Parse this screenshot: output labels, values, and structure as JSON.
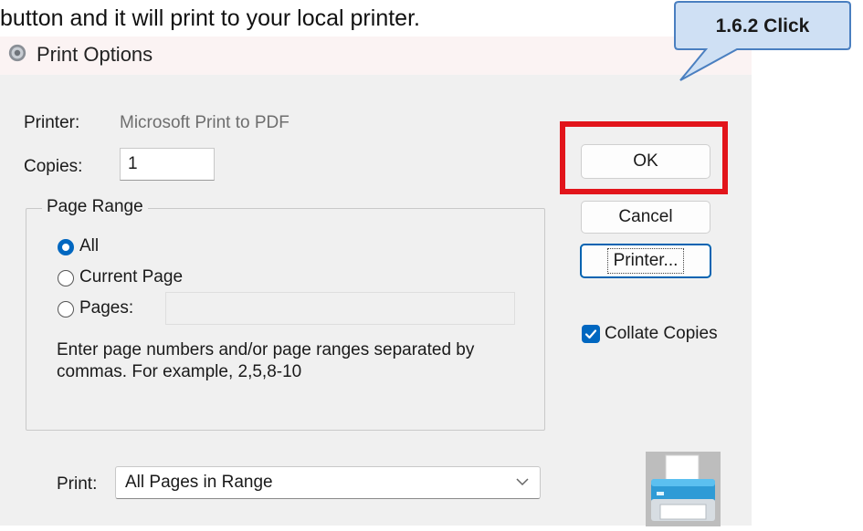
{
  "document_text": "button and it will print to your local printer.",
  "callout": {
    "label": "1.6.2 Click"
  },
  "dialog": {
    "title": "Print Options",
    "printer_label": "Printer:",
    "printer_value": "Microsoft Print to PDF",
    "copies_label": "Copies:",
    "copies_value": "1",
    "page_range": {
      "legend": "Page Range",
      "options": [
        {
          "label": "All",
          "checked": true
        },
        {
          "label": "Current Page",
          "checked": false
        },
        {
          "label": "Pages:",
          "checked": false
        }
      ],
      "pages_input_value": "",
      "hint_line1": "Enter page numbers and/or page ranges separated by",
      "hint_line2": "commas. For example, 2,5,8-10"
    },
    "buttons": {
      "ok": "OK",
      "cancel": "Cancel",
      "printer": "Printer..."
    },
    "collate": {
      "label": "Collate Copies",
      "checked": true
    },
    "print_label": "Print:",
    "print_value": "All Pages in Range"
  },
  "colors": {
    "accent": "#0067c0",
    "highlight": "#e2151b",
    "callout_fill": "#cfe0f4",
    "callout_border": "#4a7fc0"
  },
  "icons": [
    "gear-icon",
    "printer-icon",
    "chevron-down-icon",
    "checkmark-icon"
  ]
}
